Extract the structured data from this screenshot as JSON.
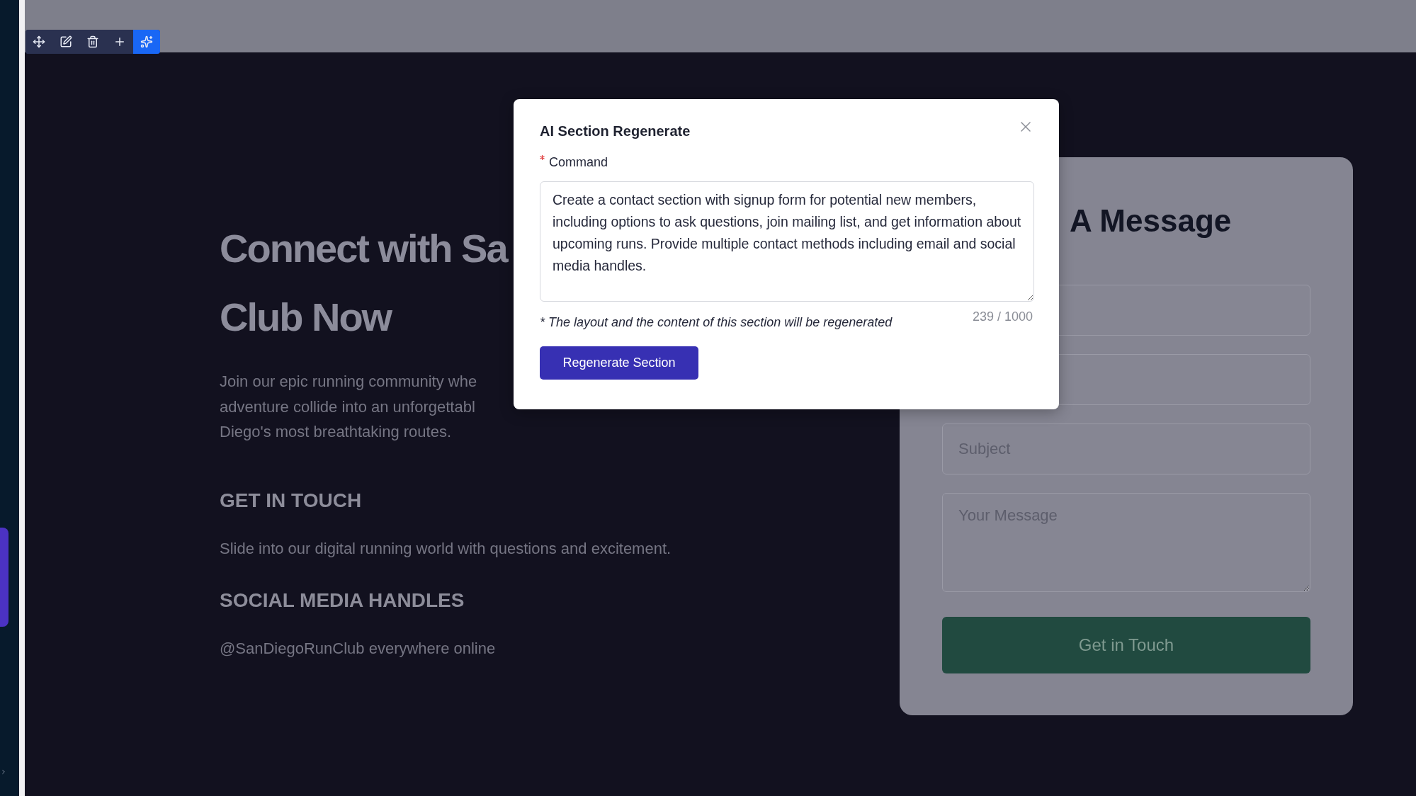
{
  "toolbar": [
    {
      "kind": "move",
      "selected": false
    },
    {
      "kind": "edit",
      "selected": false
    },
    {
      "kind": "delete",
      "selected": false
    },
    {
      "kind": "add",
      "selected": false
    },
    {
      "kind": "ai",
      "selected": true
    }
  ],
  "hero": {
    "heading_lines": [
      "Connect with Sa",
      "Club Now"
    ],
    "paragraph_lines": [
      "Join our epic running community whe",
      "adventure collide into an unforgettabl",
      "Diego's most breathtaking routes."
    ],
    "blocks": [
      {
        "heading": "GET IN TOUCH",
        "text": "Slide into our digital running world with questions and excitement."
      },
      {
        "heading": "SOCIAL MEDIA HANDLES",
        "text": "@SanDiegoRunClub everywhere online"
      }
    ]
  },
  "form": {
    "title": "A Message",
    "fields": [
      {
        "kind": "input"
      },
      {
        "kind": "input"
      },
      {
        "kind": "input",
        "placeholder": "Subject"
      },
      {
        "kind": "textarea",
        "placeholder": "Your Message"
      }
    ],
    "button": "Get in Touch"
  },
  "modal": {
    "title": "AI Section Regenerate",
    "field_label": "Command",
    "required": true,
    "value": "Create a contact section with signup form for potential new members, including options to ask questions, join mailing list, and get information about upcoming runs. Provide multiple contact methods including email and social media handles.",
    "note": "* The layout and the content of this section will be regenerated",
    "counter": "239 / 1000",
    "button": "Regenerate Section"
  }
}
